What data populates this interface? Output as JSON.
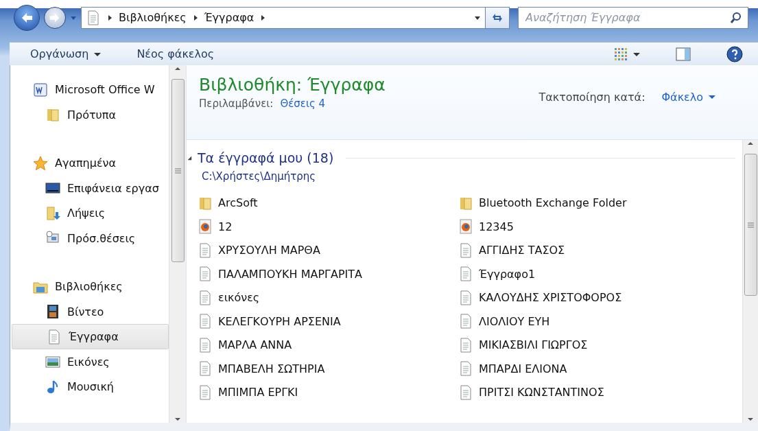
{
  "address_bar": {
    "crumbs": [
      "Βιβλιοθήκες",
      "Έγγραφα"
    ],
    "search": {
      "placeholder": "Αναζήτηση Έγγραφα"
    }
  },
  "toolbar": {
    "organize": "Οργάνωση",
    "new_folder": "Νέος φάκελος"
  },
  "sidebar": {
    "groups": [
      {
        "label": "Microsoft Office W",
        "kind": "word",
        "children": [
          {
            "label": "Πρότυπα",
            "kind": "folder",
            "selected": false
          }
        ]
      },
      {
        "label": "Αγαπημένα",
        "kind": "star",
        "children": [
          {
            "label": "Επιφάνεια εργασ",
            "kind": "desktop",
            "selected": false
          },
          {
            "label": "Λήψεις",
            "kind": "download",
            "selected": false
          },
          {
            "label": "Πρόσ.θέσεις",
            "kind": "places",
            "selected": false
          }
        ]
      },
      {
        "label": "Βιβλιοθήκες",
        "kind": "library",
        "children": [
          {
            "label": "Βίντεο",
            "kind": "video",
            "selected": false
          },
          {
            "label": "Έγγραφα",
            "kind": "document",
            "selected": true
          },
          {
            "label": "Εικόνες",
            "kind": "pictures",
            "selected": false
          },
          {
            "label": "Μουσική",
            "kind": "music",
            "selected": false
          }
        ]
      }
    ]
  },
  "library_header": {
    "title": "Βιβλιοθήκη: Έγγραφα",
    "includes_label": "Περιλαμβάνει:",
    "includes_link": "Θέσεις 4",
    "arrange_label": "Τακτοποίηση κατά:",
    "arrange_value": "Φάκελο"
  },
  "section": {
    "title": "Τα έγγραφά μου (18)",
    "path": "C:\\Χρήστες\\Δημήτρης"
  },
  "files": [
    {
      "name": "ArcSoft",
      "kind": "folder"
    },
    {
      "name": "Bluetooth Exchange Folder",
      "kind": "folder"
    },
    {
      "name": "12",
      "kind": "firefox"
    },
    {
      "name": "12345",
      "kind": "firefox"
    },
    {
      "name": "ΧΡΥΣΟΥΛΗ ΜΑΡΘΑ",
      "kind": "document"
    },
    {
      "name": "ΑΓΓΙΔΗΣ ΤΑΣΟΣ",
      "kind": "document"
    },
    {
      "name": "ΠΑΛΑΜΠΟΥΚΗ ΜΑΡΓΑΡΙΤΑ",
      "kind": "document"
    },
    {
      "name": "Έγγραφο1",
      "kind": "document"
    },
    {
      "name": "εικόνες",
      "kind": "document"
    },
    {
      "name": "ΚΑΛΟΥΔΗΣ ΧΡΙΣΤΟΦΟΡΟΣ",
      "kind": "document"
    },
    {
      "name": "ΚΕΛΕΓΚΟΥΡΗ ΑΡΣΕΝΙΑ",
      "kind": "document"
    },
    {
      "name": "ΛΙΟΛΙΟΥ ΕΥΗ",
      "kind": "document"
    },
    {
      "name": "ΜΑΡΛΑ ΑΝΝΑ",
      "kind": "document"
    },
    {
      "name": "ΜΙΚΙΑΣΒΙΛΙ ΓΙΩΡΓΟΣ",
      "kind": "document"
    },
    {
      "name": "ΜΠΑΒΕΛΗ ΣΩΤΗΡΙΑ",
      "kind": "document"
    },
    {
      "name": "ΜΠΑΡΔΙ ΕΛΙΟΝΑ",
      "kind": "document"
    },
    {
      "name": "ΜΠΙΜΠΑ ΕΡΓΚΙ",
      "kind": "document"
    },
    {
      "name": "ΠΡΙΤΣΙ ΚΩΝΣΤΑΝΤΙΝΟΣ",
      "kind": "document"
    }
  ]
}
